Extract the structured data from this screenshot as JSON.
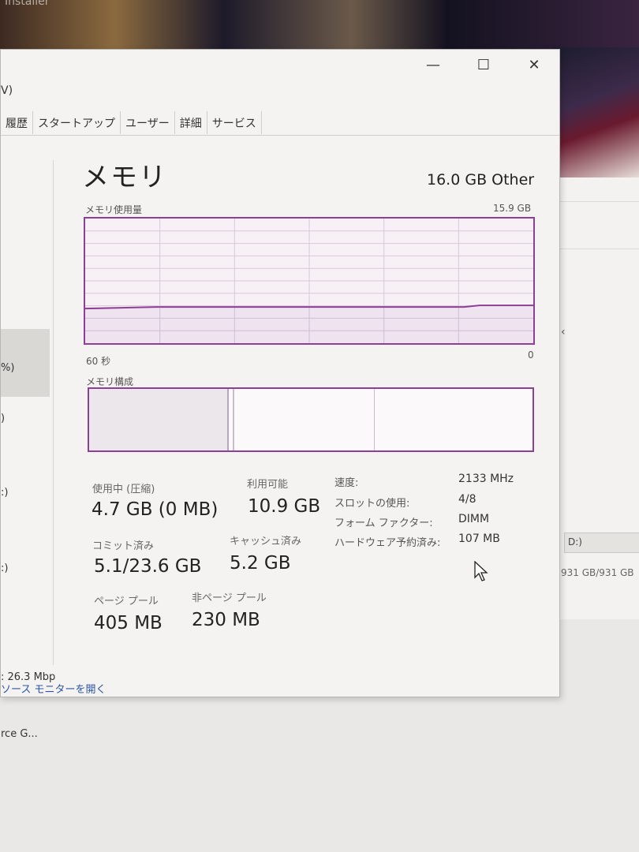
{
  "background": {
    "installer_text": "Installer",
    "back_window_drive": "D:)",
    "back_window_capacity": "931 GB/931 GB"
  },
  "window": {
    "menu_label": "V)",
    "controls": {
      "minimize": "—",
      "maximize": "☐",
      "close": "✕"
    },
    "tabs": [
      "履歴",
      "スタートアップ",
      "ユーザー",
      "詳細",
      "サービス"
    ]
  },
  "sidebar": {
    "items": [
      {
        "label": "%)"
      },
      {
        "label": ")"
      },
      {
        "label": ":)"
      },
      {
        "label": ":)"
      },
      {
        "label": ": 26.3 Mbp"
      },
      {
        "label": "rce G..."
      }
    ]
  },
  "memory": {
    "title": "メモリ",
    "total": "16.0 GB Other",
    "usage_label": "メモリ使用量",
    "usage_max": "15.9 GB",
    "time_label": "60 秒",
    "time_min": "0",
    "composition_label": "メモリ構成",
    "usage_fraction": 0.29,
    "accent_color": "#8d3f95"
  },
  "stats": {
    "in_use_label": "使用中 (圧縮)",
    "in_use_value": "4.7 GB (0 MB)",
    "available_label": "利用可能",
    "available_value": "10.9 GB",
    "committed_label": "コミット済み",
    "committed_value": "5.1/23.6 GB",
    "cached_label": "キャッシュ済み",
    "cached_value": "5.2 GB",
    "paged_label": "ページ プール",
    "paged_value": "405 MB",
    "nonpaged_label": "非ページ プール",
    "nonpaged_value": "230 MB"
  },
  "specs": [
    {
      "label": "速度:",
      "value": "2133 MHz"
    },
    {
      "label": "スロットの使用:",
      "value": "4/8"
    },
    {
      "label": "フォーム ファクター:",
      "value": "DIMM"
    },
    {
      "label": "ハードウェア予約済み:",
      "value": "107 MB"
    }
  ],
  "footer": {
    "open_monitor": "ソース モニターを開く"
  }
}
